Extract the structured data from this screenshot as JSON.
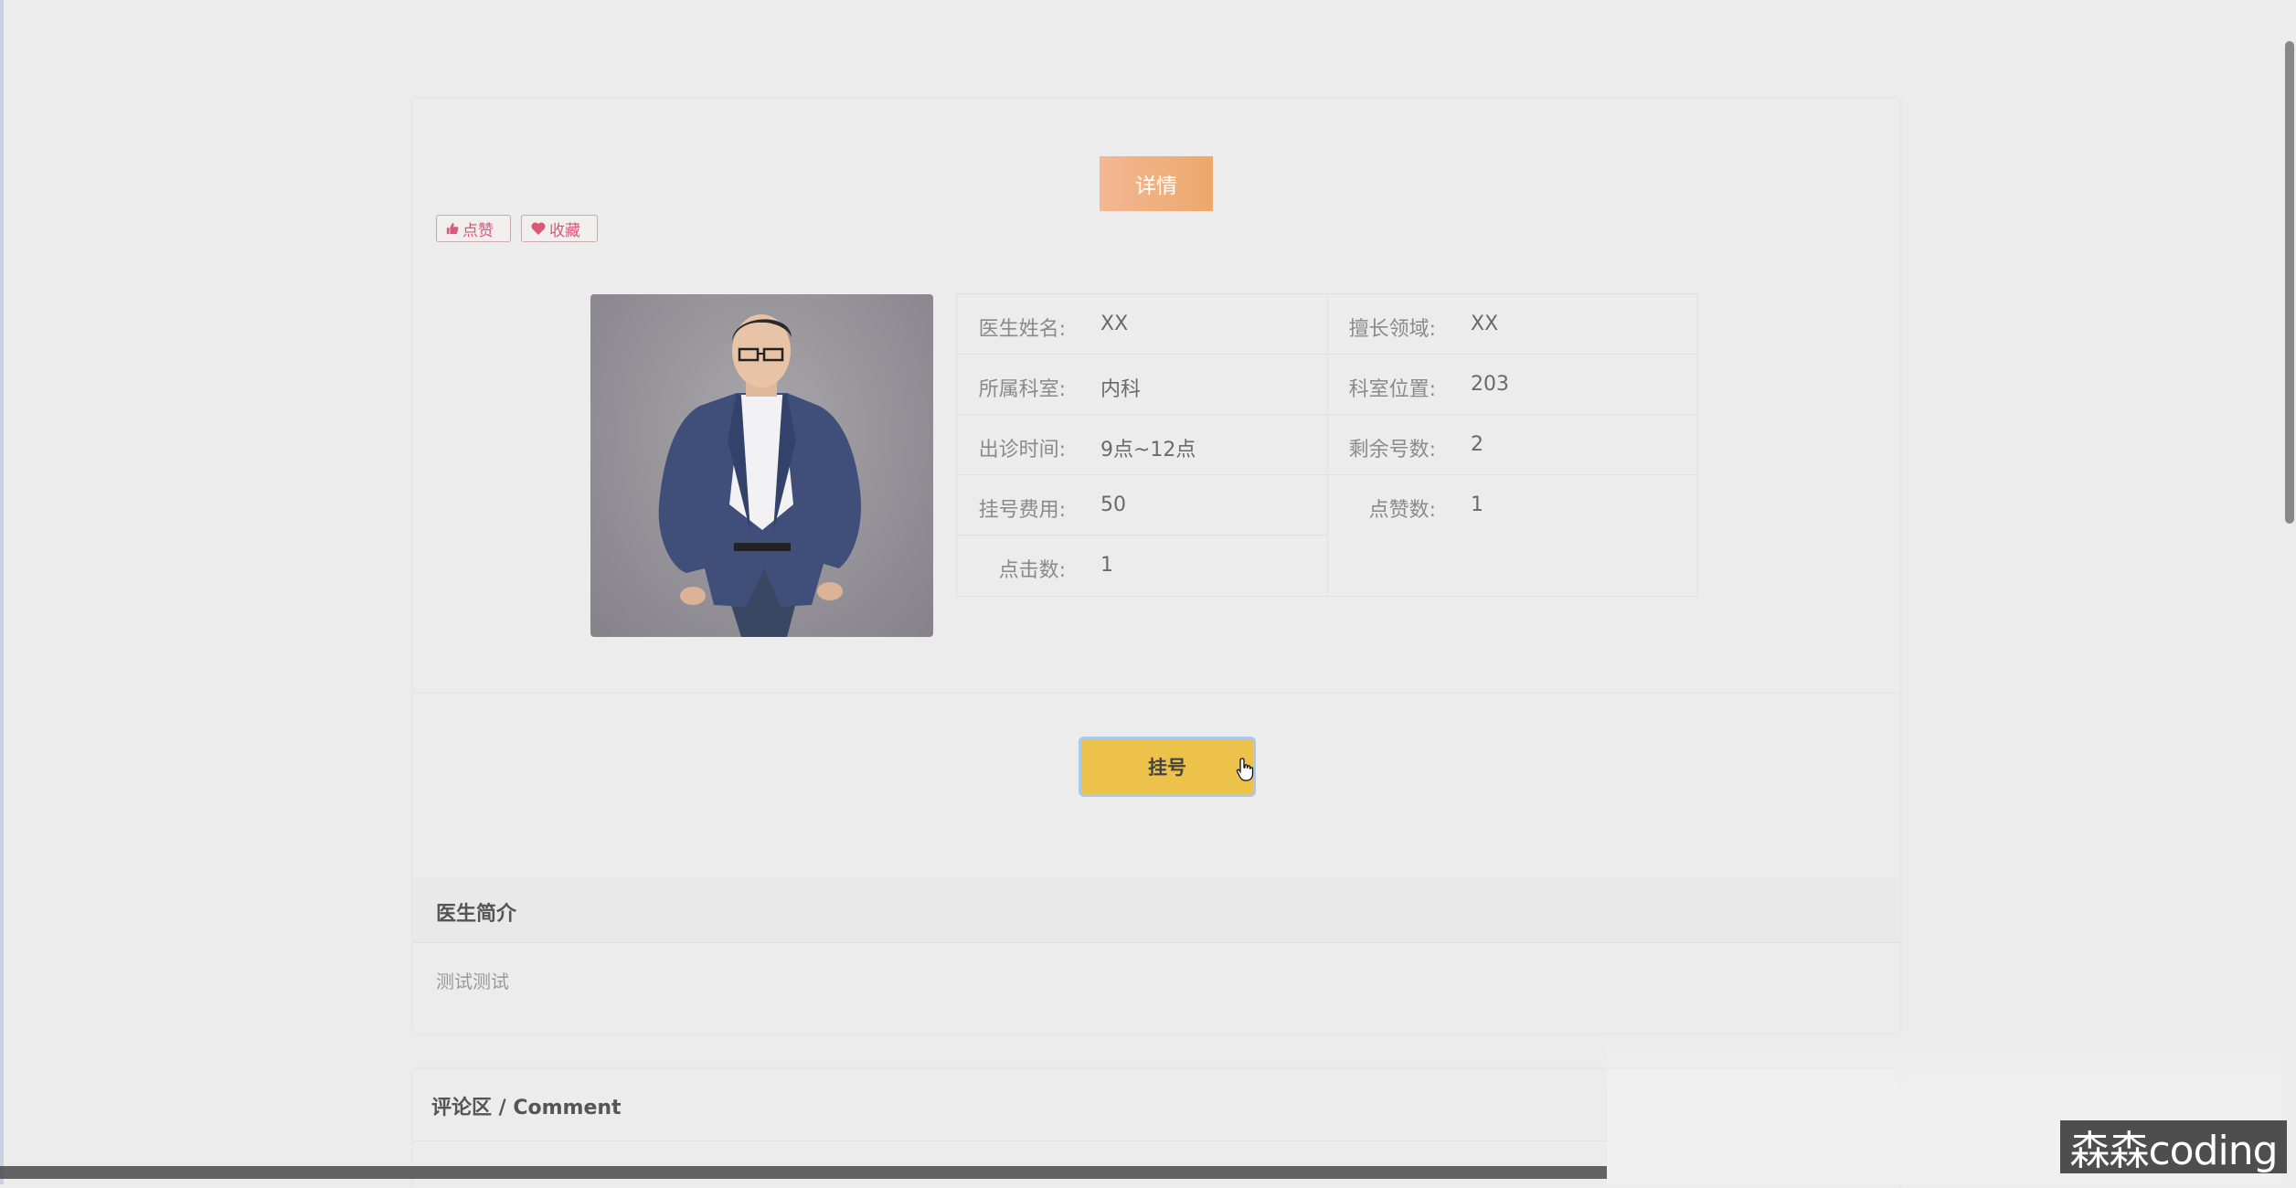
{
  "detail_tab": "详情",
  "actions": {
    "like_label": "点赞",
    "favorite_label": "收藏"
  },
  "doctor_photo": "doctor-portrait",
  "info": {
    "name_label": "医生姓名:",
    "name_value": "XX",
    "specialty_label": "擅长领域:",
    "specialty_value": "XX",
    "department_label": "所属科室:",
    "department_value": "内科",
    "location_label": "科室位置:",
    "location_value": "203",
    "time_label": "出诊时间:",
    "time_value": "9点~12点",
    "remaining_label": "剩余号数:",
    "remaining_value": "2",
    "fee_label": "挂号费用:",
    "fee_value": "50",
    "likes_label": "点赞数:",
    "likes_value": "1",
    "clicks_label": "点击数:",
    "clicks_value": "1"
  },
  "register_button": "挂号",
  "intro": {
    "title": "医生简介",
    "content": "测试测试"
  },
  "comments": {
    "title": "评论区 / Comment"
  },
  "watermark": "森森coding",
  "colors": {
    "accent": "#ecc24a",
    "tab": "#eda86a",
    "pink": "#d65a78"
  }
}
